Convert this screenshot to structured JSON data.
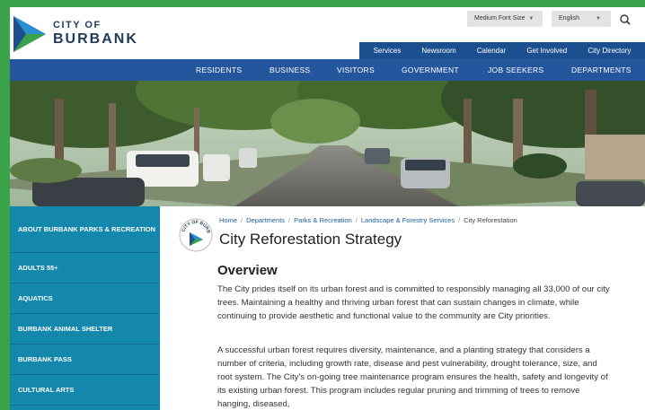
{
  "logo": {
    "line1": "CITY OF",
    "line2": "BURBANK"
  },
  "utility": {
    "font_size": "Medium Font Size",
    "language": "English"
  },
  "top_nav": [
    "Services",
    "Newsroom",
    "Calendar",
    "Get Involved",
    "City Directory"
  ],
  "main_nav": [
    "RESIDENTS",
    "BUSINESS",
    "VISITORS",
    "GOVERNMENT",
    "JOB SEEKERS",
    "DEPARTMENTS"
  ],
  "sidebar": [
    "ABOUT BURBANK PARKS & RECREATION",
    "ADULTS 55+",
    "AQUATICS",
    "BURBANK ANIMAL SHELTER",
    "BURBANK PASS",
    "CULTURAL ARTS"
  ],
  "breadcrumb": [
    "Home",
    "Departments",
    "Parks & Recreation",
    "Landscape & Forestry Services",
    "City Reforestation"
  ],
  "seal_text": "CITY OF BURBANK",
  "page_title": "City Reforestation Strategy",
  "section_title": "Overview",
  "paragraphs": [
    "The City prides itself on its urban forest and is committed to responsibly managing all 33,000 of our city trees. Maintaining a healthy and thriving urban forest that can sustain changes in climate, while continuing to provide aesthetic and functional value to the community are City priorities.",
    "A successful urban forest requires diversity, maintenance, and a planting strategy that considers a number of criteria, including growth rate, disease and pest vulnerability, drought tolerance, size, and root system. The City's on-going tree maintenance program ensures the health, safety and longevity of its existing urban forest. This program includes regular pruning and trimming of trees to remove hanging, diseased,"
  ],
  "colors": {
    "nav_dark": "#1c4f8f",
    "nav_main": "#24569e",
    "sidebar": "#1487ac",
    "border": "#3aa34a"
  }
}
